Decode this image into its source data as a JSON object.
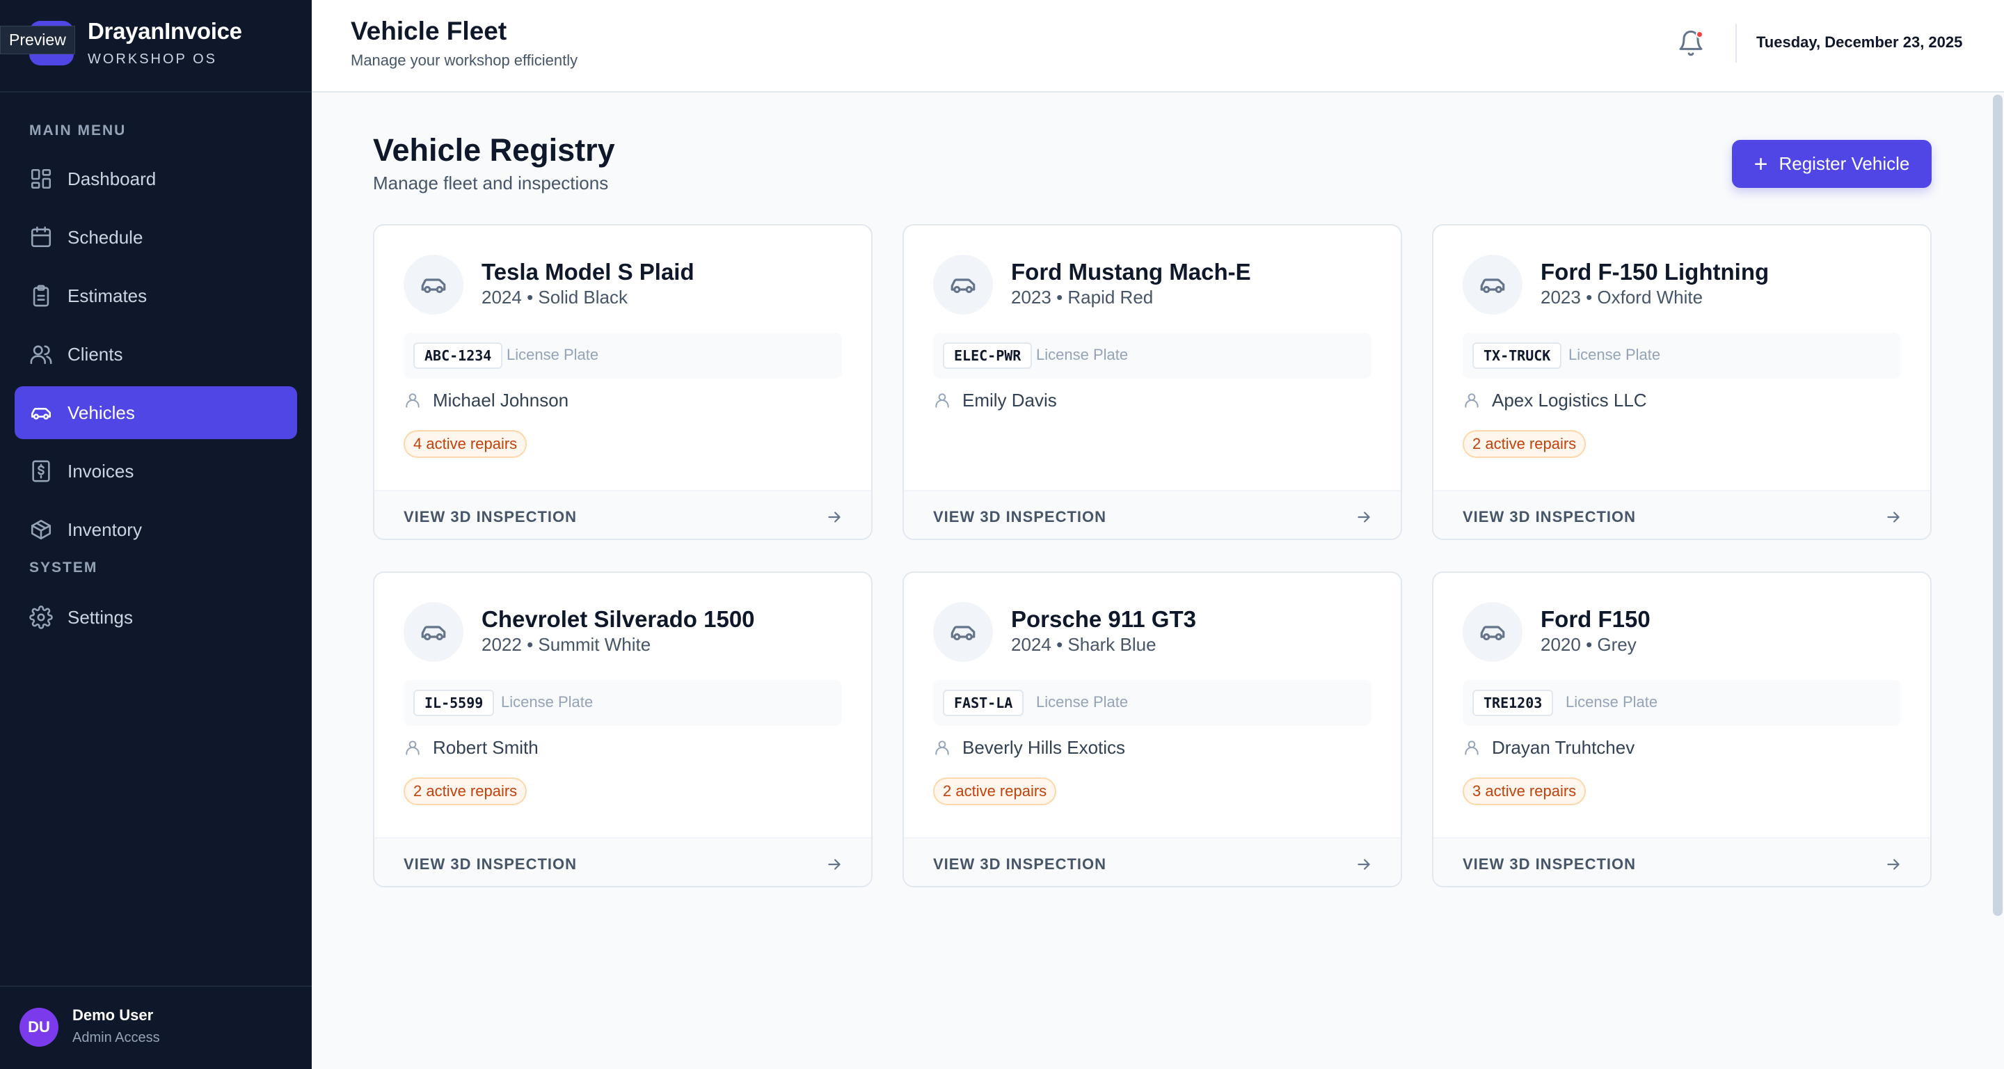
{
  "brand": {
    "name": "DrayanInvoice",
    "subtitle": "WORKSHOP OS",
    "preview_label": "Preview"
  },
  "sidebar": {
    "main_menu_label": "MAIN MENU",
    "system_label": "SYSTEM",
    "items": [
      {
        "label": "Dashboard",
        "icon": "dashboard-icon"
      },
      {
        "label": "Schedule",
        "icon": "calendar-icon"
      },
      {
        "label": "Estimates",
        "icon": "clipboard-icon"
      },
      {
        "label": "Clients",
        "icon": "users-icon"
      },
      {
        "label": "Vehicles",
        "icon": "car-icon",
        "active": true
      },
      {
        "label": "Invoices",
        "icon": "invoice-dollar-icon"
      },
      {
        "label": "Inventory",
        "icon": "box-icon"
      }
    ],
    "system_items": [
      {
        "label": "Settings",
        "icon": "gear-icon"
      }
    ]
  },
  "user": {
    "initials": "DU",
    "name": "Demo User",
    "role": "Admin Access"
  },
  "header": {
    "title": "Vehicle Fleet",
    "subtitle": "Manage your workshop efficiently",
    "date": "Tuesday, December 23, 2025",
    "notification_icon": "bell-icon"
  },
  "main": {
    "title": "Vehicle Registry",
    "subtitle": "Manage fleet and inspections",
    "register_label": "Register Vehicle"
  },
  "labels": {
    "license_plate": "License Plate",
    "view_inspection": "VIEW 3D INSPECTION"
  },
  "colors": {
    "accent": "#4f46e5",
    "sidebar_bg": "#0f172a",
    "repairs_text": "#c2410c",
    "notification_dot": "#ef4444",
    "avatar": "#7c3aed"
  },
  "vehicles": [
    {
      "name": "Tesla Model S Plaid",
      "meta": "2024 • Solid Black",
      "plate": "ABC-1234",
      "owner": "Michael Johnson",
      "repairs": "4 active repairs"
    },
    {
      "name": "Ford Mustang Mach-E",
      "meta": "2023 • Rapid Red",
      "plate": "ELEC-PWR",
      "owner": "Emily Davis",
      "repairs": ""
    },
    {
      "name": "Ford F-150 Lightning",
      "meta": "2023 • Oxford White",
      "plate": "TX-TRUCK",
      "owner": "Apex Logistics LLC",
      "repairs": "2 active repairs"
    },
    {
      "name": "Chevrolet Silverado 1500",
      "meta": "2022 • Summit White",
      "plate": "IL-5599",
      "owner": "Robert Smith",
      "repairs": "2 active repairs"
    },
    {
      "name": "Porsche 911 GT3",
      "meta": "2024 • Shark Blue",
      "plate": "FAST-LA",
      "owner": "Beverly Hills Exotics",
      "repairs": "2 active repairs"
    },
    {
      "name": "Ford F150",
      "meta": "2020 • Grey",
      "plate": "TRE1203",
      "owner": "Drayan Truhtchev",
      "repairs": "3 active repairs"
    }
  ]
}
